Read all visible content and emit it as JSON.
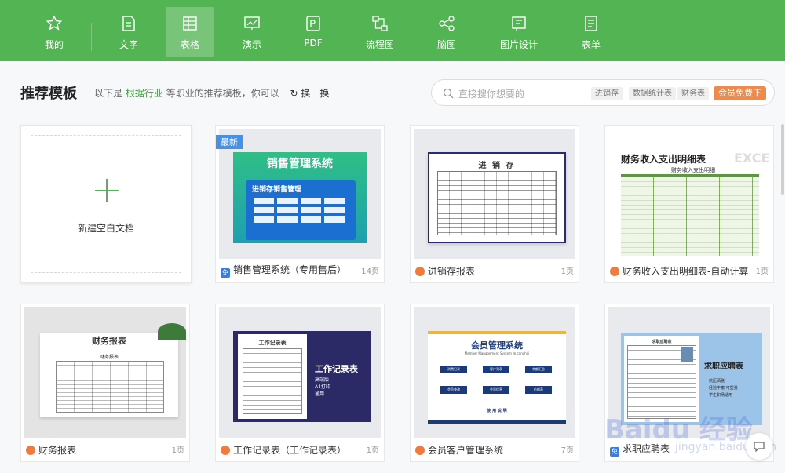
{
  "nav": [
    {
      "label": "我的",
      "icon": "star-icon"
    },
    {
      "label": "文字",
      "icon": "document-icon"
    },
    {
      "label": "表格",
      "icon": "table-icon"
    },
    {
      "label": "演示",
      "icon": "presentation-icon"
    },
    {
      "label": "PDF",
      "icon": "pdf-icon"
    },
    {
      "label": "流程图",
      "icon": "flowchart-icon"
    },
    {
      "label": "脑图",
      "icon": "mindmap-icon"
    },
    {
      "label": "图片设计",
      "icon": "image-design-icon"
    },
    {
      "label": "表单",
      "icon": "form-icon"
    }
  ],
  "header": {
    "title": "推荐模板",
    "sub_prefix": "以下是",
    "sub_link": "根据行业",
    "sub_suffix": "等职业的推荐模板，你可以",
    "refresh": "换一换"
  },
  "search": {
    "placeholder": "直接搜你想要的",
    "tags": [
      "进销存",
      "数据统计表",
      "财务表"
    ],
    "vip": "会员免费下"
  },
  "blank_card": {
    "label": "新建空白文档"
  },
  "cards": [
    {
      "name": "销售管理系统（专用售后）",
      "pages": "14页",
      "badge": "免",
      "tag": "最新",
      "thumb_title": "销售管理系统",
      "thumb_sub": "进销存销售管理"
    },
    {
      "name": "进销存报表",
      "pages": "1页",
      "badge": "",
      "thumb_title": "进 销 存"
    },
    {
      "name": "财务收入支出明细表-自动计算",
      "pages": "1页",
      "badge": "",
      "thumb_title": "财务收入支出明细表",
      "thumb_sub": "财务收入支出明细",
      "thumb_extra": "EXCEL"
    },
    {
      "name": "财务报表",
      "pages": "1页",
      "badge": "",
      "thumb_title": "财务报表",
      "thumb_sub": "财务报表"
    },
    {
      "name": "工作记录表（工作记录表）",
      "pages": "1页",
      "badge": "",
      "thumb_title": "工作记录表",
      "thumb_sub": "工作记录表",
      "thumb_lines": [
        "高端版",
        "A4打印",
        "通用"
      ]
    },
    {
      "name": "会员客户管理系统",
      "pages": "7页",
      "badge": "",
      "thumb_title": "会员管理系统",
      "thumb_sub": "Member Management System @ canghai",
      "thumb_btns": [
        "消费记录",
        "客户列表",
        "余额汇总",
        "会员查询",
        "会员信息",
        "价格表"
      ],
      "thumb_foot": "使 用 说 明"
    },
    {
      "name": "求职应聘表",
      "pages": "",
      "badge": "免",
      "thumb_title": "求职应聘表",
      "thumb_sub": "求职应聘表",
      "thumb_lines": [
        "抗压洒脱",
        "经验丰富,可塑强",
        "学生职场适用"
      ]
    }
  ],
  "watermark": {
    "main": "Baidu 经验",
    "sub": "jingyan.baidu.com"
  },
  "colors": {
    "green": "#52b452",
    "accent": "#f08a4b",
    "link": "#3d9a3d"
  }
}
